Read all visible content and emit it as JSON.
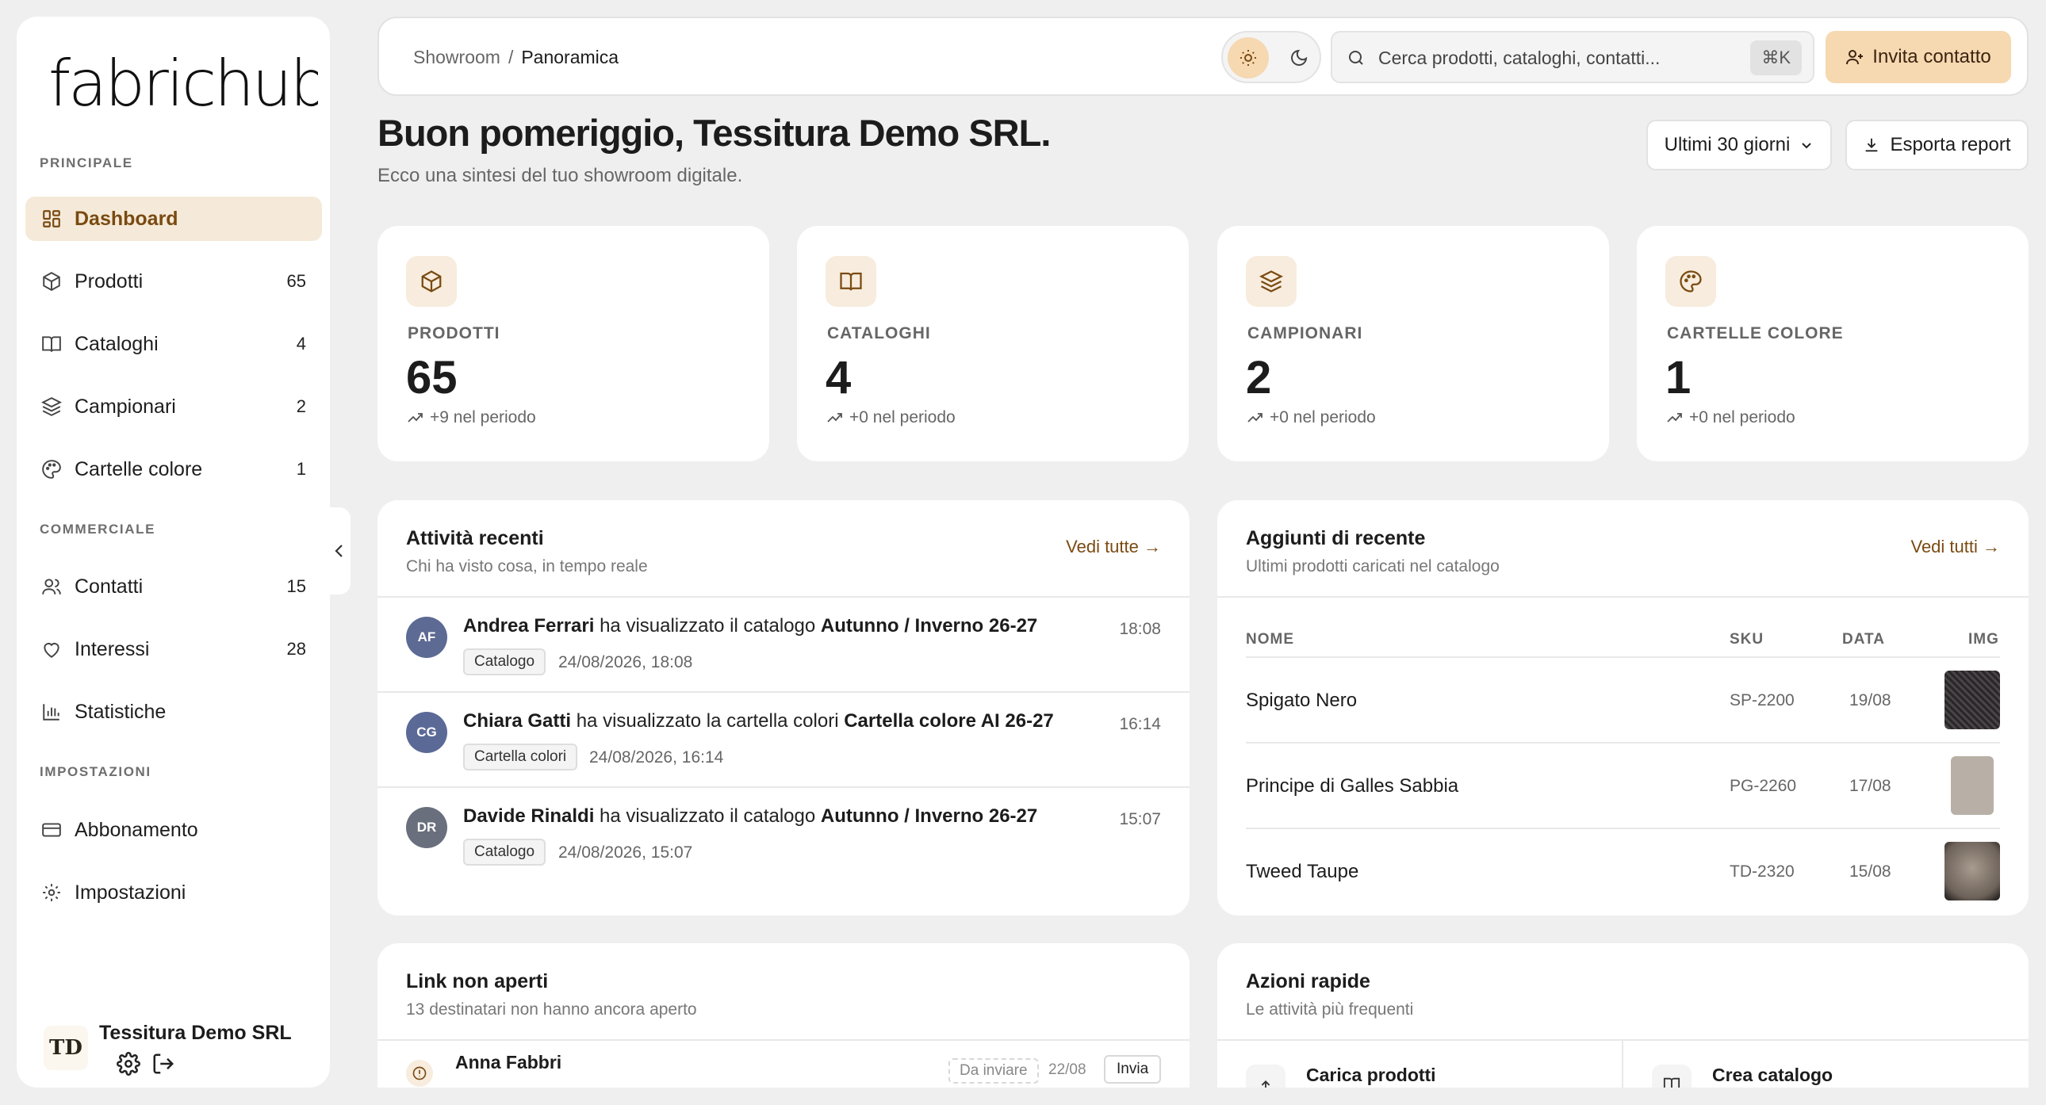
{
  "brand": {
    "logo_text": "fabrichub",
    "accent": "#f6d8b1",
    "accent_dark": "#7a4a12"
  },
  "sidebar": {
    "sections": [
      {
        "label": "PRINCIPALE"
      },
      {
        "label": "COMMERCIALE"
      },
      {
        "label": "IMPOSTAZIONI"
      }
    ],
    "items": [
      {
        "label": "Dashboard",
        "count": "",
        "icon": "dashboard-icon",
        "active": true
      },
      {
        "label": "Prodotti",
        "count": "65",
        "icon": "box-icon"
      },
      {
        "label": "Cataloghi",
        "count": "4",
        "icon": "book-icon"
      },
      {
        "label": "Campionari",
        "count": "2",
        "icon": "layers-icon"
      },
      {
        "label": "Cartelle colore",
        "count": "1",
        "icon": "palette-icon"
      },
      {
        "label": "Contatti",
        "count": "15",
        "icon": "users-icon"
      },
      {
        "label": "Interessi",
        "count": "28",
        "icon": "heart-icon"
      },
      {
        "label": "Statistiche",
        "count": "",
        "icon": "chart-icon"
      },
      {
        "label": "Abbonamento",
        "count": "",
        "icon": "card-icon"
      },
      {
        "label": "Impostazioni",
        "count": "",
        "icon": "gear-icon"
      }
    ],
    "user": {
      "initials": "TD",
      "name": "Tessitura Demo SRL"
    }
  },
  "topbar": {
    "breadcrumb": {
      "parent": "Showroom",
      "separator": "/",
      "current": "Panoramica"
    },
    "search_placeholder": "Cerca prodotti, cataloghi, contatti...",
    "search_shortcut": "⌘K",
    "invite_label": "Invita contatto"
  },
  "header": {
    "greeting": "Buon pomeriggio, Tessitura Demo SRL.",
    "subtitle": "Ecco una sintesi del tuo showroom digitale.",
    "period_label": "Ultimi 30 giorni",
    "export_label": "Esporta report"
  },
  "stats": [
    {
      "label": "PRODOTTI",
      "value": "65",
      "delta": "+9 nel periodo",
      "icon": "box-icon"
    },
    {
      "label": "CATALOGHI",
      "value": "4",
      "delta": "+0 nel periodo",
      "icon": "book-icon"
    },
    {
      "label": "CAMPIONARI",
      "value": "2",
      "delta": "+0 nel periodo",
      "icon": "layers-icon"
    },
    {
      "label": "CARTELLE COLORE",
      "value": "1",
      "delta": "+0 nel periodo",
      "icon": "palette-icon"
    }
  ],
  "activity": {
    "title": "Attività recenti",
    "subtitle": "Chi ha visto cosa, in tempo reale",
    "link": "Vedi tutte →",
    "items": [
      {
        "initials": "AF",
        "name": "Andrea Ferrari",
        "action": "ha visualizzato il catalogo",
        "target": "Autunno / Inverno 26-27",
        "tag": "Catalogo",
        "date": "24/08/2026, 18:08",
        "time": "18:08"
      },
      {
        "initials": "CG",
        "name": "Chiara Gatti",
        "action": "ha visualizzato la cartella colori",
        "target": "Cartella colore AI 26-27",
        "tag": "Cartella colori",
        "date": "24/08/2026, 16:14",
        "time": "16:14"
      },
      {
        "initials": "DR",
        "name": "Davide Rinaldi",
        "action": "ha visualizzato il catalogo",
        "target": "Autunno / Inverno 26-27",
        "tag": "Catalogo",
        "date": "24/08/2026, 15:07",
        "time": "15:07"
      }
    ]
  },
  "recent": {
    "title": "Aggiunti di recente",
    "subtitle": "Ultimi prodotti caricati nel catalogo",
    "link": "Vedi tutti →",
    "columns": {
      "name": "NOME",
      "sku": "SKU",
      "date": "DATA",
      "img": "IMG"
    },
    "rows": [
      {
        "name": "Spigato Nero",
        "sku": "SP-2200",
        "date": "19/08",
        "swatch": "#3a3538"
      },
      {
        "name": "Principe di Galles Sabbia",
        "sku": "PG-2260",
        "date": "17/08",
        "swatch": "#b8b0a6"
      },
      {
        "name": "Tweed Taupe",
        "sku": "TD-2320",
        "date": "15/08",
        "swatch": "#8a7e73"
      }
    ]
  },
  "unopened": {
    "title": "Link non aperti",
    "subtitle": "13 destinatari non hanno ancora aperto",
    "first": {
      "name": "Anna Fabbri",
      "status": "Da inviare",
      "date": "22/08",
      "action": "Invia"
    }
  },
  "quick": {
    "title": "Azioni rapide",
    "subtitle": "Le attività più frequenti",
    "actions": [
      {
        "label": "Carica prodotti",
        "icon": "upload-icon"
      },
      {
        "label": "Crea catalogo",
        "icon": "book-icon"
      }
    ]
  }
}
